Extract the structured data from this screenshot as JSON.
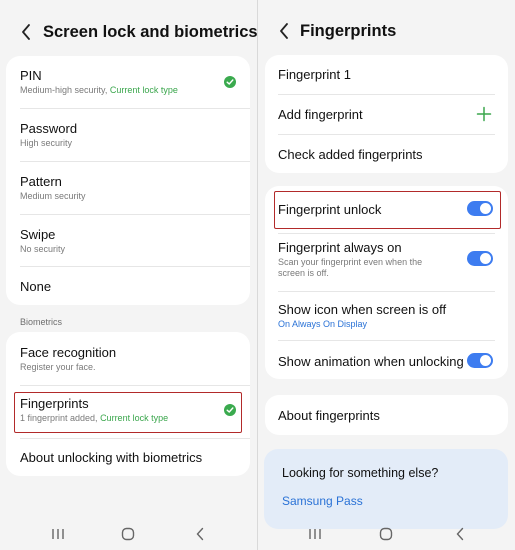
{
  "left": {
    "title": "Screen lock and biometrics",
    "lock_items": [
      {
        "title": "PIN",
        "subtitle": "Medium-high security, ",
        "subtitle_accent": "Current lock type"
      },
      {
        "title": "Password",
        "subtitle": "High security"
      },
      {
        "title": "Pattern",
        "subtitle": "Medium security"
      },
      {
        "title": "Swipe",
        "subtitle": "No security"
      },
      {
        "title": "None"
      }
    ],
    "biometrics_label": "Biometrics",
    "bio_items": [
      {
        "title": "Face recognition",
        "subtitle": "Register your face."
      },
      {
        "title": "Fingerprints",
        "subtitle": "1 fingerprint added, ",
        "subtitle_accent": "Current lock type"
      },
      {
        "title": "About unlocking with biometrics"
      }
    ]
  },
  "right": {
    "title": "Fingerprints",
    "fp_items": [
      {
        "title": "Fingerprint 1"
      },
      {
        "title": "Add fingerprint"
      },
      {
        "title": "Check added fingerprints"
      }
    ],
    "settings": [
      {
        "title": "Fingerprint unlock",
        "on": true
      },
      {
        "title": "Fingerprint always on",
        "subtitle_line1": "Scan your fingerprint even when the",
        "subtitle_line2": "screen is off.",
        "on": true
      },
      {
        "title": "Show icon when screen is off",
        "subtitle": "On Always On Display"
      },
      {
        "title": "Show animation when unlocking",
        "on": true
      }
    ],
    "about": "About fingerprints",
    "looking_title": "Looking for something else?",
    "looking_link": "Samsung Pass"
  },
  "colors": {
    "accent_green": "#3aa64c",
    "accent_blue": "#2a72d6",
    "toggle_on": "#3d7cf0",
    "highlight_red": "#b22a2a"
  },
  "icons": [
    "back-arrow-icon",
    "check-circle-icon",
    "plus-icon",
    "recent-apps-icon",
    "home-icon",
    "back-nav-icon"
  ]
}
